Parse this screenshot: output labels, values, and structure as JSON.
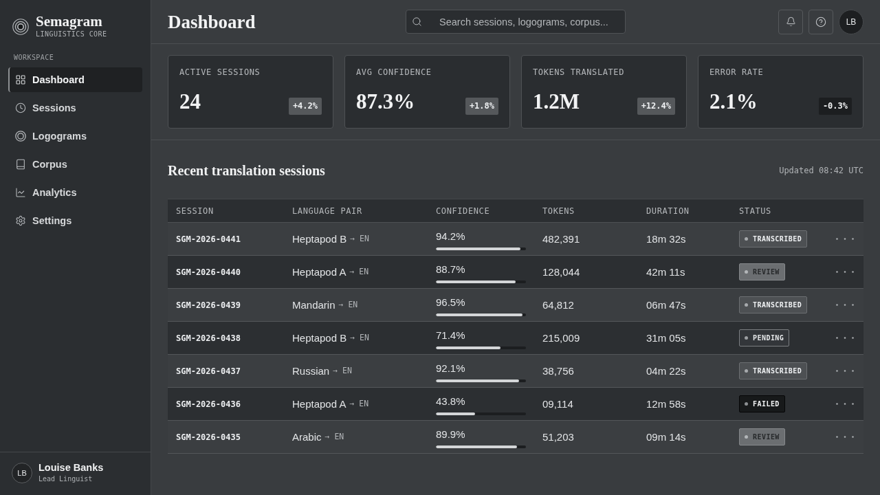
{
  "sidebar": {
    "brand": {
      "name": "Semagram",
      "tagline": "LINGUISTICS CORE"
    },
    "section_label": "WORKSPACE",
    "items": [
      {
        "label": "Dashboard",
        "selected": true
      },
      {
        "label": "Sessions",
        "selected": false
      },
      {
        "label": "Logograms",
        "selected": false
      },
      {
        "label": "Corpus",
        "selected": false
      },
      {
        "label": "Analytics",
        "selected": false
      },
      {
        "label": "Settings",
        "selected": false
      }
    ],
    "user": {
      "initials": "LB",
      "name": "Louise Banks",
      "role": "Lead Linguist"
    }
  },
  "header": {
    "title": "Dashboard",
    "search": {
      "placeholder": "Search sessions, logograms, corpus..."
    },
    "avatar": "LB"
  },
  "stats": [
    {
      "label": "ACTIVE SESSIONS",
      "value": "24",
      "change": "+4.2%",
      "kind": "up"
    },
    {
      "label": "AVG CONFIDENCE",
      "value": "87.3%",
      "change": "+1.8%",
      "kind": "up"
    },
    {
      "label": "TOKENS TRANSLATED",
      "value": "1.2M",
      "change": "+12.4%",
      "kind": "up"
    },
    {
      "label": "ERROR RATE",
      "value": "2.1%",
      "change": "-0.3%",
      "kind": "down"
    }
  ],
  "sessions": {
    "title": "Recent translation sessions",
    "updated": "Updated 08:42 UTC",
    "columns": [
      "SESSION",
      "LANGUAGE PAIR",
      "CONFIDENCE",
      "TOKENS",
      "DURATION",
      "STATUS"
    ],
    "rows": [
      {
        "session": "SGM-2026-0441",
        "source": "Heptapod B",
        "target": "→ EN",
        "confidence": "94.2%",
        "level": 0.942,
        "tokens": "482,391",
        "duration": "18m 32s",
        "status": {
          "label": "TRANSCRIBED",
          "kind": "transcribed"
        }
      },
      {
        "session": "SGM-2026-0440",
        "source": "Heptapod A",
        "target": "→ EN",
        "confidence": "88.7%",
        "level": 0.887,
        "tokens": "128,044",
        "duration": "42m 11s",
        "status": {
          "label": "REVIEW",
          "kind": "review"
        }
      },
      {
        "session": "SGM-2026-0439",
        "source": "Mandarin",
        "target": "→ EN",
        "confidence": "96.5%",
        "level": 0.965,
        "tokens": "64,812",
        "duration": "06m 47s",
        "status": {
          "label": "TRANSCRIBED",
          "kind": "transcribed"
        }
      },
      {
        "session": "SGM-2026-0438",
        "source": "Heptapod B",
        "target": "→ EN",
        "confidence": "71.4%",
        "level": 0.714,
        "tokens": "215,009",
        "duration": "31m 05s",
        "status": {
          "label": "PENDING",
          "kind": "pending"
        }
      },
      {
        "session": "SGM-2026-0437",
        "source": "Russian",
        "target": "→ EN",
        "confidence": "92.1%",
        "level": 0.921,
        "tokens": "38,756",
        "duration": "04m 22s",
        "status": {
          "label": "TRANSCRIBED",
          "kind": "transcribed"
        }
      },
      {
        "session": "SGM-2026-0436",
        "source": "Heptapod A",
        "target": "→ EN",
        "confidence": "43.8%",
        "level": 0.438,
        "tokens": "09,114",
        "duration": "12m 58s",
        "status": {
          "label": "FAILED",
          "kind": "failed"
        }
      },
      {
        "session": "SGM-2026-0435",
        "source": "Arabic",
        "target": "→ EN",
        "confidence": "89.9%",
        "level": 0.899,
        "tokens": "51,203",
        "duration": "09m 14s",
        "status": {
          "label": "REVIEW",
          "kind": "review"
        }
      }
    ]
  }
}
